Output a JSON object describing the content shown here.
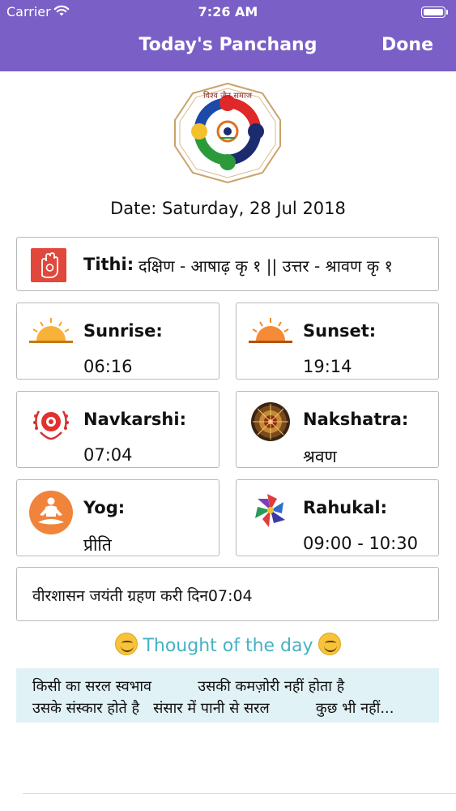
{
  "status_bar": {
    "carrier": "Carrier",
    "time": "7:26 AM"
  },
  "nav": {
    "title": "Today's Panchang",
    "done_label": "Done",
    "color": "#7a5fc6"
  },
  "logo": {
    "text": "विश्व जैन समाज"
  },
  "date_text": "Date: Saturday, 28 Jul 2018",
  "tithi": {
    "label": "Tithi:",
    "value": "दक्षिण - आषाढ़ कृ १ || उत्तर - श्रावण कृ १",
    "icon": "jain-hand-icon"
  },
  "cards": {
    "sunrise": {
      "label": "Sunrise:",
      "value": "06:16",
      "icon": "sunrise-icon"
    },
    "sunset": {
      "label": "Sunset:",
      "value": "19:14",
      "icon": "sunset-icon"
    },
    "navkarshi": {
      "label": "Navkarshi:",
      "value": "07:04",
      "icon": "navkarshi-emblem-icon"
    },
    "nakshatra": {
      "label": "Nakshatra:",
      "value": "श्रवण",
      "icon": "nakshatra-wheel-icon"
    },
    "yog": {
      "label": "Yog:",
      "value": "प्रीति",
      "icon": "meditation-icon"
    },
    "rahukal": {
      "label": "Rahukal:",
      "value": "09:00 - 10:30",
      "icon": "pinwheel-icon"
    }
  },
  "event": {
    "text": "वीरशासन जयंती   ग्रहण करी दिन07:04"
  },
  "thought": {
    "title": "Thought of the day",
    "color": "#46b1c4",
    "line1": "किसी का सरल स्वभाव          उसकी कमज़ोरी नहीं होता है",
    "line2": "उसके संस्कार होते है   संसार में पानी से सरल          कुछ भी नहीं..."
  }
}
